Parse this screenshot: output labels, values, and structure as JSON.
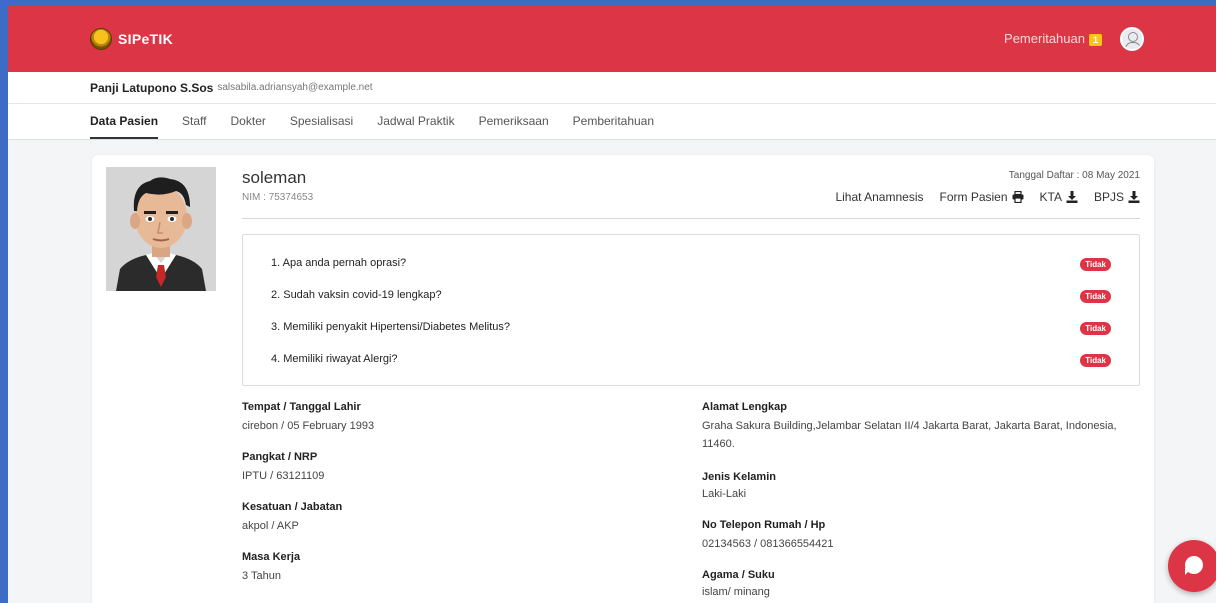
{
  "header": {
    "brand": "SIPeTIK",
    "notifications_label": "Pemeritahuan",
    "notifications_count": "1"
  },
  "user": {
    "name": "Panji Latupono S.Sos",
    "email": "salsabila.adriansyah@example.net"
  },
  "tabs": [
    {
      "label": "Data Pasien",
      "active": true
    },
    {
      "label": "Staff"
    },
    {
      "label": "Dokter"
    },
    {
      "label": "Spesialisasi"
    },
    {
      "label": "Jadwal Praktik"
    },
    {
      "label": "Pemeriksaan"
    },
    {
      "label": "Pemberitahuan"
    }
  ],
  "patient": {
    "name": "soleman",
    "nim": "NIM : 75374653",
    "registered": "Tanggal Daftar : 08 May 2021"
  },
  "actions": {
    "anamnesis": "Lihat Anamnesis",
    "form": "Form Pasien",
    "kta": "KTA",
    "bpjs": "BPJS"
  },
  "questions": [
    {
      "text": "1.  Apa anda pernah oprasi?",
      "answer": "Tidak"
    },
    {
      "text": "2.  Sudah vaksin covid-19 lengkap?",
      "answer": "Tidak"
    },
    {
      "text": "3.  Memiliki penyakit Hipertensi/Diabetes Melitus?",
      "answer": "Tidak"
    },
    {
      "text": "4.  Memiliki riwayat Alergi?",
      "answer": "Tidak"
    }
  ],
  "info_left": [
    {
      "label": "Tempat / Tanggal Lahir",
      "value": "cirebon / 05 February 1993"
    },
    {
      "label": "Pangkat / NRP",
      "value": "IPTU / 63121109"
    },
    {
      "label": "Kesatuan / Jabatan",
      "value": "akpol / AKP"
    },
    {
      "label": "Masa Kerja",
      "value": "3 Tahun"
    }
  ],
  "info_right": [
    {
      "label": "Alamat Lengkap",
      "value": "Graha Sakura Building,Jelambar Selatan II/4 Jakarta Barat, Jakarta Barat, Indonesia, 11460."
    },
    {
      "label": "Jenis Kelamin",
      "value": "Laki-Laki"
    },
    {
      "label": "No Telepon Rumah / Hp",
      "value": "02134563 / 081366554421"
    },
    {
      "label": "Agama / Suku",
      "value": "islam/ minang"
    }
  ],
  "colors": {
    "primary_red": "#dc3545",
    "frame_blue": "#3e6cc4"
  },
  "icons": {
    "logo": "police-emblem-logo",
    "avatar": "user-avatar-icon",
    "print": "printer-icon",
    "download": "download-icon",
    "chat": "chat-icon"
  }
}
